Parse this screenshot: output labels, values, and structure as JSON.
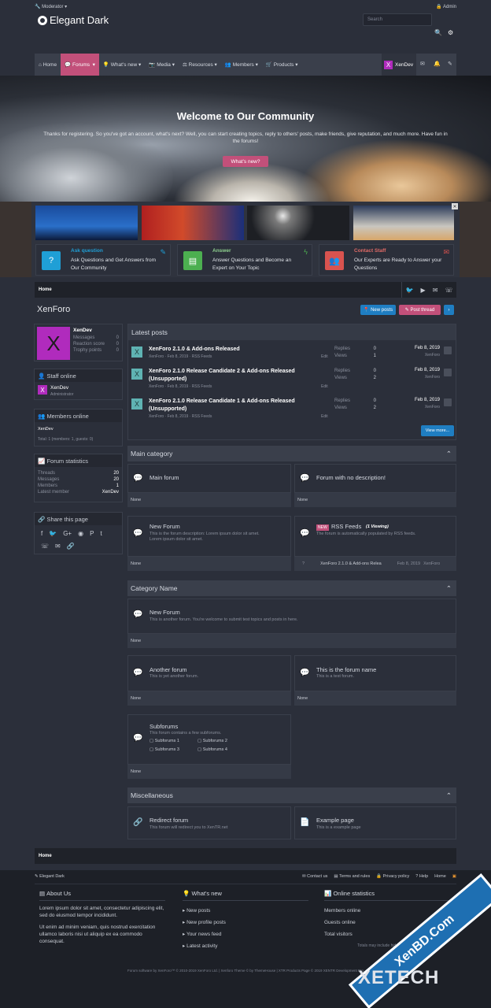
{
  "topbar": {
    "moderator": "Moderator",
    "admin": "Admin"
  },
  "header": {
    "brand": "Elegant Dark",
    "search_placeholder": "Search"
  },
  "nav": {
    "items": [
      "Home",
      "Forums",
      "What's new",
      "Media",
      "Resources",
      "Members",
      "Products"
    ],
    "user": "XenDev"
  },
  "hero": {
    "title": "Welcome to Our Community",
    "text": "Thanks for registering. So you've got an account, what's next? Well, you can start creating topics, reply to others' posts, make friends, give reputation, and much more. Have fun in the forums!",
    "button": "What's new?"
  },
  "cards": [
    {
      "title": "Ask question",
      "text": "Ask Questions and Get Answers from Our Community",
      "color": "#1f9fd6"
    },
    {
      "title": "Answer",
      "text": "Answer Questions and Become an Expert on Your Topic",
      "color": "#4caf50"
    },
    {
      "title": "Contact Staff",
      "text": "Our Experts are Ready to Answer your Questions",
      "color": "#d9534f"
    }
  ],
  "breadcrumb": {
    "home": "Home"
  },
  "page": {
    "title": "XenForo",
    "new_posts": "New posts",
    "post_thread": "Post thread"
  },
  "profile": {
    "name": "XenDev",
    "avatar": "X",
    "stats": [
      [
        "Messages",
        "0"
      ],
      [
        "Reaction score",
        "0"
      ],
      [
        "Trophy points",
        "0"
      ]
    ]
  },
  "staff": {
    "title": "Staff online",
    "name": "XenDev",
    "role": "Administrator"
  },
  "members_online": {
    "title": "Members online",
    "name": "XenDev",
    "total": "Total: 1 (members: 1, guests: 0)"
  },
  "stats": {
    "title": "Forum statistics",
    "rows": [
      [
        "Threads",
        "20"
      ],
      [
        "Messages",
        "20"
      ],
      [
        "Members",
        "1"
      ],
      [
        "Latest member",
        "XenDev"
      ]
    ]
  },
  "share": {
    "title": "Share this page"
  },
  "latest": {
    "title": "Latest posts",
    "view_more": "View more...",
    "posts": [
      {
        "title": "XenForo 2.1.0 & Add-ons Released",
        "meta": "XenForo · Feb 8, 2019 · RSS Feeds",
        "edit": "Edit",
        "replies": "0",
        "views": "1",
        "date": "Feb 8, 2019",
        "author": "XenForo"
      },
      {
        "title": "XenForo 2.1.0 Release Candidate 2 & Add-ons Released (Unsupported)",
        "meta": "XenForo · Feb 8, 2019 · RSS Feeds",
        "edit": "Edit",
        "replies": "0",
        "views": "2",
        "date": "Feb 8, 2019",
        "author": "XenForo"
      },
      {
        "title": "XenForo 2.1.0 Release Candidate 1 & Add-ons Released (Unsupported)",
        "meta": "XenForo · Feb 8, 2019 · RSS Feeds",
        "edit": "Edit",
        "replies": "0",
        "views": "2",
        "date": "Feb 8, 2019",
        "author": "XenForo"
      }
    ],
    "labels": {
      "replies": "Replies",
      "views": "Views"
    }
  },
  "main_cat": {
    "title": "Main category",
    "f1": "Main forum",
    "f2": "Forum with no description!",
    "none": "None",
    "f3": "New Forum",
    "f3d": "This is the forum description: Lorem ipsum dolor sit amet. Lorem ipsum dolor sit amet.",
    "f4": "RSS Feeds",
    "f4v": "(1 Viewing)",
    "f4d": "The forum is automatically populated by RSS feeds.",
    "new": "NEW",
    "f4last": "XenForo 2.1.0 & Add-ons Relea",
    "f4date": "Feb 8, 2019",
    "f4author": "XenForo"
  },
  "cat2": {
    "title": "Category Name",
    "f1": "New Forum",
    "f1d": "This is another forum. You're welcome to submit test topics and posts in here.",
    "f2": "Another forum",
    "f2d": "This is yet another forum.",
    "f3": "This is the forum name",
    "f3d": "This is a test forum.",
    "f4": "Subforums",
    "f4d": "This forum contains a few subforums.",
    "subs": [
      "Subforums 1",
      "Subforums 2",
      "Subforums 3",
      "Subforums 4"
    ],
    "none": "None"
  },
  "misc": {
    "title": "Miscellaneous",
    "f1": "Redirect forum",
    "f1d": "This forum will redirect you to XenTR.net",
    "f2": "Example page",
    "f2d": "This is a example page"
  },
  "footer": {
    "brand": "Elegant Dark",
    "links": [
      "Contact us",
      "Terms and rules",
      "Privacy policy",
      "Help",
      "Home"
    ],
    "about_title": "About Us",
    "about1": "Lorem ipsum dolor sit amet, consectetur adipiscing elit, sed do eiusmod tempor incididunt.",
    "about2": "Ut enim ad minim veniam, quis nostrud exercitation ullamco laboris nisi ut aliquip ex ea commodo consequat.",
    "whatsnew_title": "What's new",
    "whatsnew": [
      "New posts",
      "New profile posts",
      "Your news feed",
      "Latest activity"
    ],
    "online_title": "Online statistics",
    "online": [
      "Members online",
      "Guests online",
      "Total visitors"
    ],
    "online_vals": [
      "0",
      "0",
      "0"
    ],
    "online_note": "Totals may include hidden visitors.",
    "copyright": "Forum software by XenForo™ © 2010-2019 XenForo Ltd. | Xenforo Theme © by ThemeHouse | XTR Products Page © 2019 XENTR Development Pro"
  },
  "watermark": {
    "site": "XenBD.Com",
    "brand": "XETECH"
  }
}
